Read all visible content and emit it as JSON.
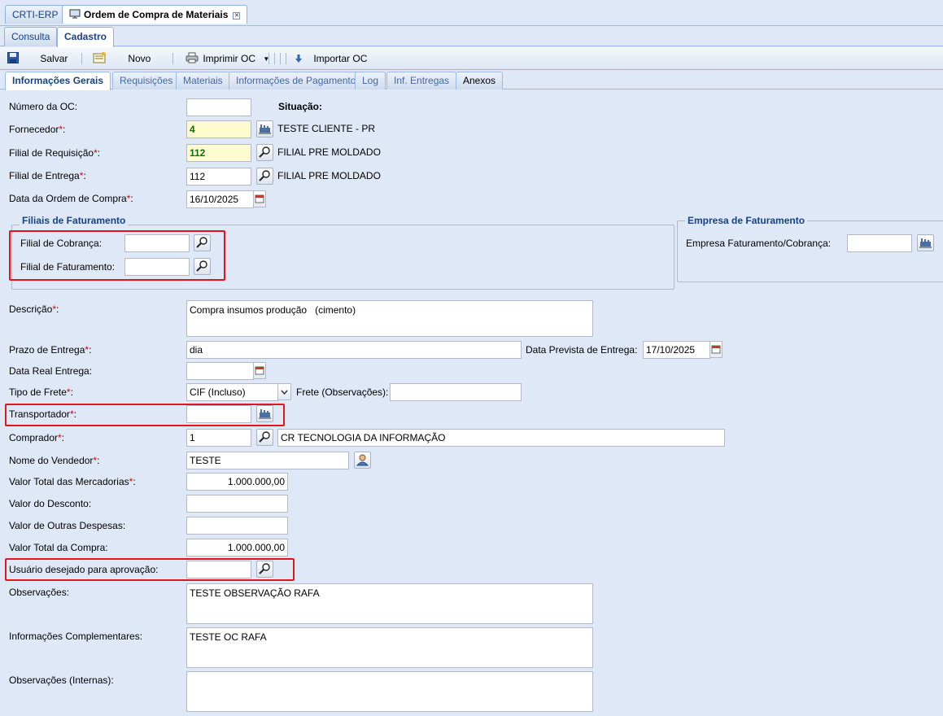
{
  "window_tabs": [
    {
      "label": "CRTI-ERP",
      "active": false
    },
    {
      "label": "Ordem de Compra de Materiais",
      "active": true,
      "close_icon": "close-icon"
    }
  ],
  "mode_tabs": [
    {
      "label": "Consulta",
      "active": false
    },
    {
      "label": "Cadastro",
      "active": true
    }
  ],
  "toolbar": {
    "save_label": "Salvar",
    "new_label": "Novo",
    "print_label": "Imprimir OC",
    "import_label": "Importar OC"
  },
  "form_tabs": [
    {
      "label": "Informações Gerais",
      "active": true
    },
    {
      "label": "Requisições"
    },
    {
      "label": "Materiais"
    },
    {
      "label": "Informações de Pagamento"
    },
    {
      "label": "Log"
    },
    {
      "label": "Inf. Entregas"
    },
    {
      "label": "Anexos"
    }
  ],
  "form": {
    "numero_oc": {
      "label": "Número da OC:",
      "value": ""
    },
    "situacao": {
      "label": "Situação:"
    },
    "fornecedor": {
      "label": "Fornecedor",
      "value": "4",
      "name": "TESTE CLIENTE - PR"
    },
    "filial_requisicao": {
      "label": "Filial de Requisição",
      "value": "112",
      "name": "FILIAL PRE MOLDADO"
    },
    "filial_entrega": {
      "label": "Filial de Entrega",
      "value": "112",
      "name": "FILIAL PRE MOLDADO"
    },
    "data_oc": {
      "label": "Data da Ordem de Compra",
      "value": "16/10/2025"
    },
    "filiais_faturamento": {
      "title": "Filiais de Faturamento",
      "cobranca_label": "Filial de Cobrança:",
      "cobranca_value": "",
      "faturamento_label": "Filial de Faturamento:",
      "faturamento_value": ""
    },
    "empresa_faturamento": {
      "title": "Empresa de Faturamento",
      "label": "Empresa Faturamento/Cobrança:",
      "value": ""
    },
    "descricao": {
      "label": "Descrição",
      "value": "Compra insumos produção   (cimento)"
    },
    "prazo_entrega": {
      "label": "Prazo de Entrega",
      "value": "dia"
    },
    "data_prevista": {
      "label": "Data Prevista de Entrega:",
      "value": "17/10/2025"
    },
    "data_real": {
      "label": "Data Real Entrega:",
      "value": ""
    },
    "tipo_frete": {
      "label": "Tipo de Frete",
      "value": "CIF (Incluso)"
    },
    "frete_obs": {
      "label": "Frete (Observações):",
      "value": ""
    },
    "transportador": {
      "label": "Transportador",
      "value": ""
    },
    "comprador": {
      "label": "Comprador",
      "value": "1",
      "name": "CR TECNOLOGIA DA INFORMAÇÃO"
    },
    "vendedor": {
      "label": "Nome do Vendedor",
      "value": "TESTE"
    },
    "valor_mercadorias": {
      "label": "Valor Total das Mercadorias",
      "value": "1.000.000,00"
    },
    "valor_desconto": {
      "label": "Valor do Desconto:",
      "value": ""
    },
    "outras_despesas": {
      "label": "Valor de Outras Despesas:",
      "value": ""
    },
    "valor_total": {
      "label": "Valor Total da Compra:",
      "value": "1.000.000,00"
    },
    "usuario_aprovacao": {
      "label": "Usuário desejado para aprovação:",
      "value": ""
    },
    "observacoes": {
      "label": "Observações:",
      "value": "TESTE OBSERVAÇÃO RAFA"
    },
    "info_complementares": {
      "label": "Informações Complementares:",
      "value": "TESTE OC RAFA"
    },
    "obs_internas": {
      "label": "Observações (Internas):",
      "value": ""
    }
  },
  "required_mark": "*:",
  "icons": {
    "lookup": "magnifier-lookup-icon",
    "supplier": "factory-lookup-icon",
    "calendar": "calendar-icon",
    "person": "person-lookup-icon"
  },
  "colors": {
    "accent": "#15428b",
    "required": "#dd0000",
    "highlight_box": "#e4141b",
    "lookup_field": "#fffbd0"
  }
}
